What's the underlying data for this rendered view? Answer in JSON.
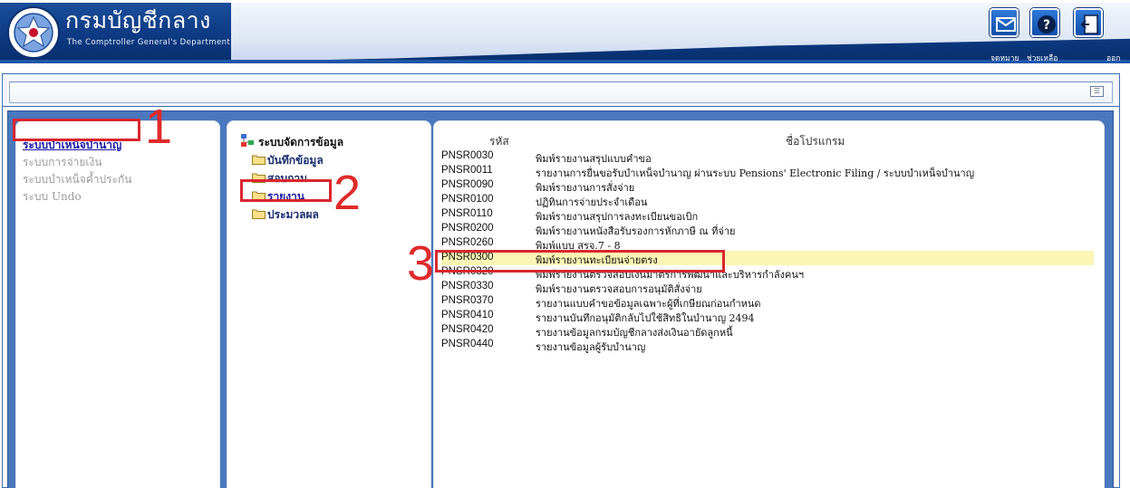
{
  "header": {
    "org_name_th": "กรมบัญชีกลาง",
    "org_name_en": "The Comptroller General's Department",
    "buttons": [
      {
        "icon": "mail-icon",
        "label": "จดหมาย"
      },
      {
        "icon": "help-icon",
        "label": "ช่วยเหลือ"
      },
      {
        "icon": "exit-icon",
        "label": "ออก"
      }
    ],
    "colors": {
      "bar": "#0d3a83",
      "swoosh": "#dfe8f5",
      "button": "#1f64c4"
    }
  },
  "toolbar": {
    "menu_icon": "menu-icon"
  },
  "systems": [
    "ระบบบำเหน็จบำนาญ",
    "ระบบการจ่ายเงิน",
    "ระบบบำเหน็จค้ำประกัน",
    "ระบบ Undo"
  ],
  "tree": {
    "root": "ระบบจัดการข้อมูล",
    "items": [
      "บันทึกข้อมูล",
      "สอบถาม",
      "รายงาน",
      "ประมวลผล"
    ]
  },
  "programs": {
    "columns": {
      "code": "รหัส",
      "name": "ชื่อโปรแกรม"
    },
    "rows": [
      {
        "code": "PNSR0030",
        "name": "พิมพ์รายงานสรุปแบบคำขอ"
      },
      {
        "code": "PNSR0011",
        "name": "รายงานการยื่นขอรับบำเหน็จบำนาญ ผ่านระบบ Pensions' Electronic Filing / ระบบบำเหน็จบำนาญ"
      },
      {
        "code": "PNSR0090",
        "name": "พิมพ์รายงานการสั่งจ่าย"
      },
      {
        "code": "PNSR0100",
        "name": "ปฏิทินการจ่ายประจำเดือน"
      },
      {
        "code": "PNSR0110",
        "name": "พิมพ์รายงานสรุปการลงทะเบียนขอเบิก"
      },
      {
        "code": "PNSR0200",
        "name": "พิมพ์รายงานหนังสือรับรองการหักภาษี ณ ที่จ่าย"
      },
      {
        "code": "PNSR0260",
        "name": "พิมพ์แบบ สรจ.7 - 8"
      },
      {
        "code": "PNSR0300",
        "name": "พิมพ์รายงานทะเบียนจ่ายตรง"
      },
      {
        "code": "PNSR0320",
        "name": "พิมพ์รายงานตรวจสอบเงินมาตรการพัฒนาและบริหารกำลังคนฯ"
      },
      {
        "code": "PNSR0330",
        "name": "พิมพ์รายงานตรวจสอบการอนุมัติสั่งจ่าย"
      },
      {
        "code": "PNSR0370",
        "name": "รายงานแบบคำขอข้อมูลเฉพาะผู้ที่เกษียณก่อนกำหนด"
      },
      {
        "code": "PNSR0410",
        "name": "รายงานบันทึกอนุมัติกลับไปใช้สิทธิในบำนาญ 2494"
      },
      {
        "code": "PNSR0420",
        "name": "รายงานข้อมูลกรมบัญชีกลางส่งเงินอายัดลูกหนี้"
      },
      {
        "code": "PNSR0440",
        "name": "รายงานข้อมูลผู้รับบำนาญ"
      }
    ]
  },
  "annotations": [
    "1",
    "2",
    "3"
  ]
}
